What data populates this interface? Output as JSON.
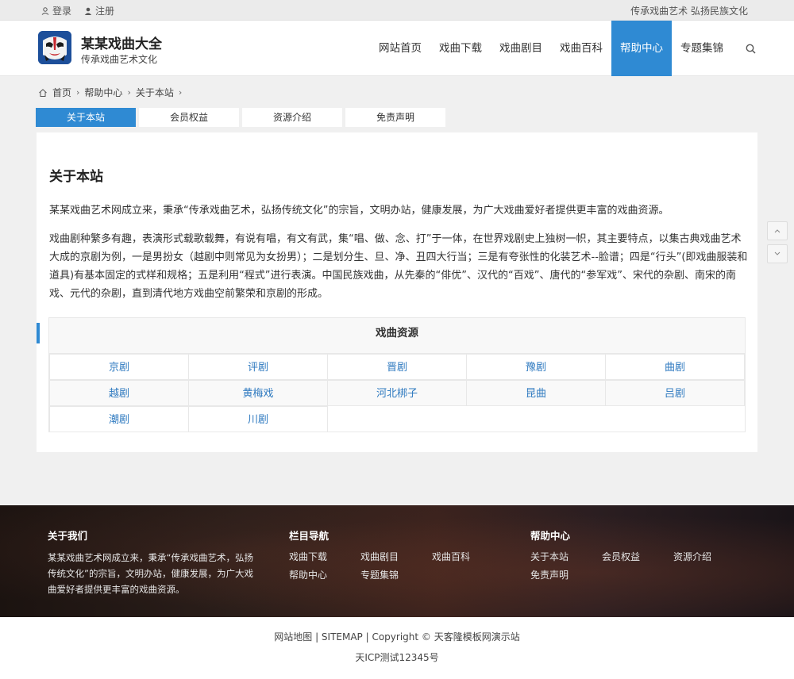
{
  "topbar": {
    "login": "登录",
    "register": "注册",
    "slogan": "传承戏曲艺术 弘扬民族文化"
  },
  "header": {
    "site_name": "某某戏曲大全",
    "site_tagline": "传承戏曲艺术文化",
    "nav": [
      {
        "label": "网站首页"
      },
      {
        "label": "戏曲下载"
      },
      {
        "label": "戏曲剧目"
      },
      {
        "label": "戏曲百科"
      },
      {
        "label": "帮助中心",
        "active": true
      },
      {
        "label": "专题集锦"
      }
    ],
    "search_icon": "search-icon"
  },
  "breadcrumb": [
    "首页",
    "帮助中心",
    "关于本站"
  ],
  "tabs": [
    "关于本站",
    "会员权益",
    "资源介绍",
    "免责声明"
  ],
  "article": {
    "title": "关于本站",
    "p1": "某某戏曲艺术网成立来，秉承“传承戏曲艺术，弘扬传统文化”的宗旨，文明办站，健康发展，为广大戏曲爱好者提供更丰富的戏曲资源。",
    "p2": "戏曲剧种繁多有趣，表演形式载歌载舞，有说有唱，有文有武，集“唱、做、念、打”于一体，在世界戏剧史上独树一帜，其主要特点，以集古典戏曲艺术大成的京剧为例，一是男扮女（越剧中则常见为女扮男）；二是划分生、旦、净、丑四大行当；三是有夸张性的化装艺术--脸谱；四是“行头”(即戏曲服装和道具)有基本固定的式样和规格；五是利用“程式”进行表演。中国民族戏曲，从先秦的“俳优”、汉代的“百戏”、唐代的“参军戏”、宋代的杂剧、南宋的南戏、元代的杂剧，直到清代地方戏曲空前繁荣和京剧的形成。"
  },
  "resources": {
    "title": "戏曲资源",
    "rows": [
      [
        "京剧",
        "评剧",
        "晋剧",
        "豫剧",
        "曲剧"
      ],
      [
        "越剧",
        "黄梅戏",
        "河北梆子",
        "昆曲",
        "吕剧"
      ],
      [
        "潮剧",
        "川剧"
      ]
    ]
  },
  "footer": {
    "about_title": "关于我们",
    "about_text": "某某戏曲艺术网成立来，秉承“传承戏曲艺术，弘扬传统文化”的宗旨，文明办站，健康发展，为广大戏曲爱好者提供更丰富的戏曲资源。",
    "nav_title": "栏目导航",
    "nav_links": [
      "戏曲下载",
      "戏曲剧目",
      "戏曲百科",
      "帮助中心",
      "专题集锦"
    ],
    "help_title": "帮助中心",
    "help_links": [
      "关于本站",
      "会员权益",
      "资源介绍",
      "免责声明"
    ]
  },
  "bottom": {
    "line1": "网站地图 | SITEMAP | Copyright © 天客隆模板网演示站",
    "line2": "天ICP测试12345号"
  },
  "colors": {
    "accent": "#2f8ad3",
    "link": "#2f7ac0"
  }
}
